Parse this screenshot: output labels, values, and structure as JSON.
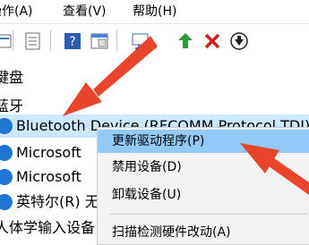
{
  "menubar": {
    "items": [
      "操作(A)",
      "查看(V)",
      "帮助(H)"
    ]
  },
  "toolbar": {
    "buttons": [
      "back-icon",
      "properties-icon",
      "help-icon",
      "console-icon",
      "scan-hardware-icon",
      "update-driver-icon",
      "uninstall-icon",
      "disable-icon"
    ]
  },
  "tree": {
    "rows": [
      {
        "label": "键盘",
        "kind": "category"
      },
      {
        "label": "蓝牙",
        "kind": "category"
      },
      {
        "label": "Bluetooth Device (RFCOMM Protocol TDI)",
        "kind": "device",
        "icon": "bluetooth-icon",
        "selected": true
      },
      {
        "label": "Microsoft",
        "kind": "device",
        "icon": "bluetooth-icon"
      },
      {
        "label": "Microsoft",
        "kind": "device",
        "icon": "bluetooth-icon"
      },
      {
        "label": "英特尔(R) 无",
        "kind": "device",
        "icon": "bluetooth-icon"
      },
      {
        "label": "人体学输入设备",
        "kind": "category"
      }
    ]
  },
  "context_menu": {
    "items": [
      {
        "label": "更新驱动程序(P)",
        "highlighted": true
      },
      {
        "label": "禁用设备(D)"
      },
      {
        "label": "卸载设备(U)"
      },
      {
        "label": "扫描检测硬件改动(A)",
        "separator_before": true
      }
    ]
  },
  "colors": {
    "annotation_arrow": "#e8452c",
    "selection": "#cce8ff",
    "menu_highlight": "#91c9f7",
    "bluetooth": "#1f74d4"
  }
}
